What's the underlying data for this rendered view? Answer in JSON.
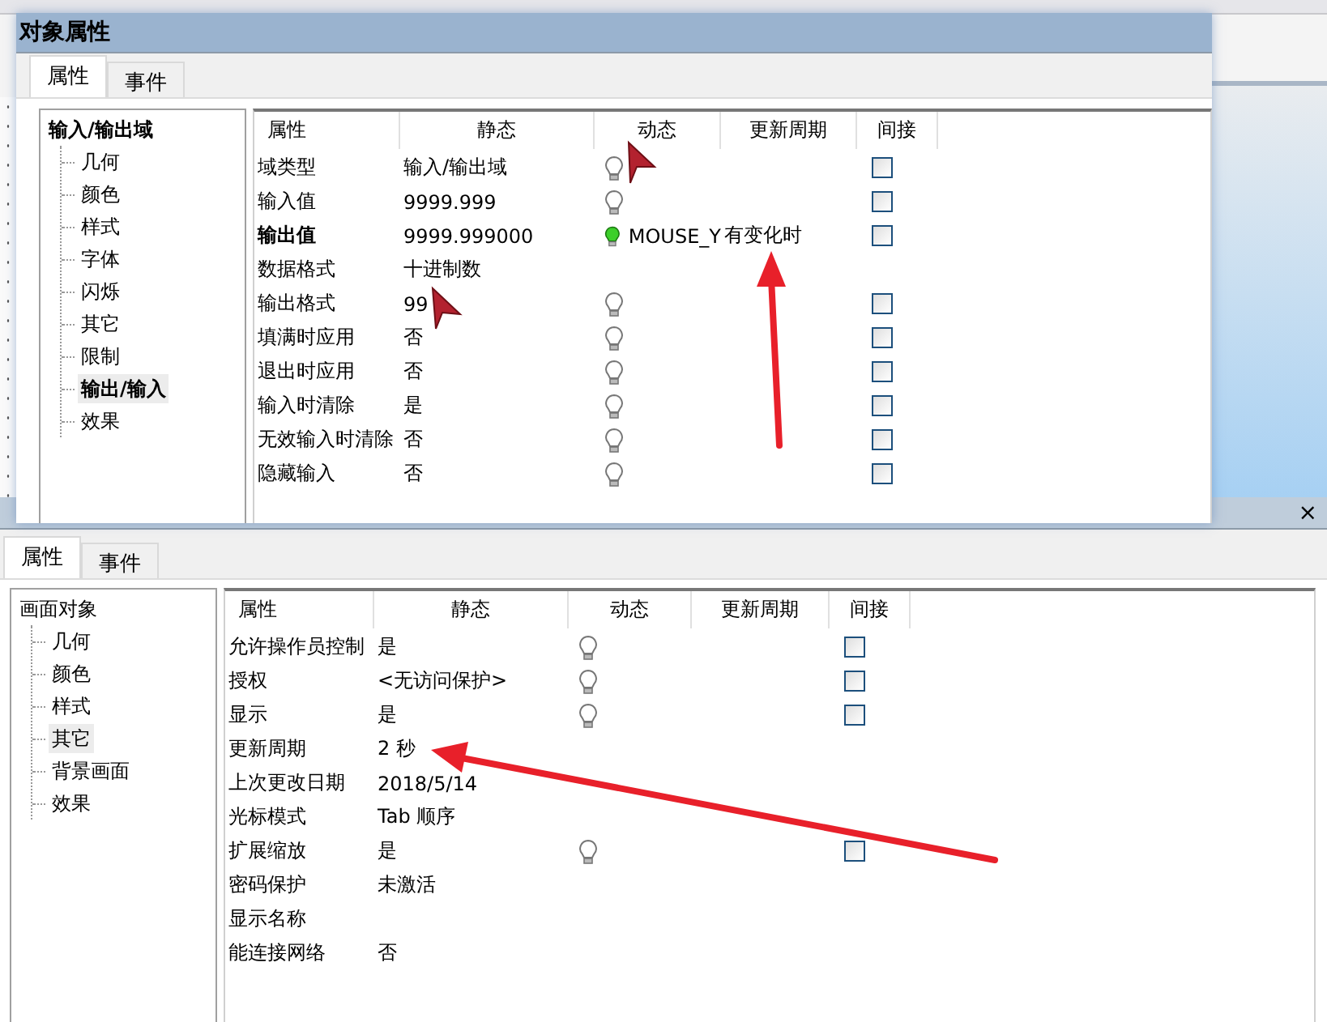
{
  "windows": [
    {
      "title": "对象属性",
      "tabs": [
        {
          "label": "属性",
          "selected": true
        },
        {
          "label": "事件",
          "selected": false
        }
      ],
      "tree": {
        "label": "输入/输出域",
        "bold": true,
        "children": [
          {
            "label": "几何",
            "selected": false
          },
          {
            "label": "颜色",
            "selected": false
          },
          {
            "label": "样式",
            "selected": false
          },
          {
            "label": "字体",
            "selected": false
          },
          {
            "label": "闪烁",
            "selected": false
          },
          {
            "label": "其它",
            "selected": false
          },
          {
            "label": "限制",
            "selected": false
          },
          {
            "label": "输出/输入",
            "selected": true
          },
          {
            "label": "效果",
            "selected": false
          }
        ]
      },
      "table": {
        "columns": [
          "属性",
          "静态",
          "动态",
          "更新周期",
          "间接"
        ],
        "rows": [
          {
            "property": "域类型",
            "bold": false,
            "static": "输入/输出域",
            "lit": false,
            "indirect": false
          },
          {
            "property": "输入值",
            "bold": false,
            "static": "9999.999",
            "lit": false,
            "indirect": false
          },
          {
            "property": "输出值",
            "bold": true,
            "static": "9999.999000",
            "lit": true,
            "dynamic": "MOUSE_Y",
            "update_cycle": "有变化时",
            "indirect": false
          },
          {
            "property": "数据格式",
            "bold": false,
            "static": "十进制数"
          },
          {
            "property": "输出格式",
            "bold": false,
            "static": "99",
            "lit": false,
            "indirect": false
          },
          {
            "property": "填满时应用",
            "bold": false,
            "static": "否",
            "lit": false,
            "indirect": false
          },
          {
            "property": "退出时应用",
            "bold": false,
            "static": "否",
            "lit": false,
            "indirect": false
          },
          {
            "property": "输入时清除",
            "bold": false,
            "static": "是",
            "lit": false,
            "indirect": false
          },
          {
            "property": "无效输入时清除",
            "bold": false,
            "static": "否",
            "lit": false,
            "indirect": false
          },
          {
            "property": "隐藏输入",
            "bold": false,
            "static": "否",
            "lit": false,
            "indirect": false
          }
        ]
      }
    },
    {
      "close": "×",
      "tabs": [
        {
          "label": "属性",
          "selected": true
        },
        {
          "label": "事件",
          "selected": false
        }
      ],
      "tree": {
        "label": "画面对象",
        "bold": false,
        "children": [
          {
            "label": "几何",
            "selected": false
          },
          {
            "label": "颜色",
            "selected": false
          },
          {
            "label": "样式",
            "selected": false
          },
          {
            "label": "其它",
            "selected": true
          },
          {
            "label": "背景画面",
            "selected": false
          },
          {
            "label": "效果",
            "selected": false
          }
        ]
      },
      "table": {
        "columns": [
          "属性",
          "静态",
          "动态",
          "更新周期",
          "间接"
        ],
        "rows": [
          {
            "property": "允许操作员控制",
            "bold": false,
            "static": "是",
            "lit": false,
            "indirect": false
          },
          {
            "property": "授权",
            "bold": false,
            "static": "<无访问保护>",
            "lit": false,
            "indirect": false
          },
          {
            "property": "显示",
            "bold": false,
            "static": "是",
            "lit": false,
            "indirect": false
          },
          {
            "property": "更新周期",
            "bold": false,
            "static": "2 秒"
          },
          {
            "property": "上次更改日期",
            "bold": false,
            "static": "2018/5/14"
          },
          {
            "property": "光标模式",
            "bold": false,
            "static": "Tab 顺序"
          },
          {
            "property": "扩展缩放",
            "bold": false,
            "static": "是",
            "lit": false,
            "indirect": false
          },
          {
            "property": "密码保护",
            "bold": false,
            "static": "未激活"
          },
          {
            "property": "显示名称",
            "bold": false
          },
          {
            "property": "能连接网络",
            "bold": false,
            "static": "否"
          }
        ]
      }
    }
  ]
}
